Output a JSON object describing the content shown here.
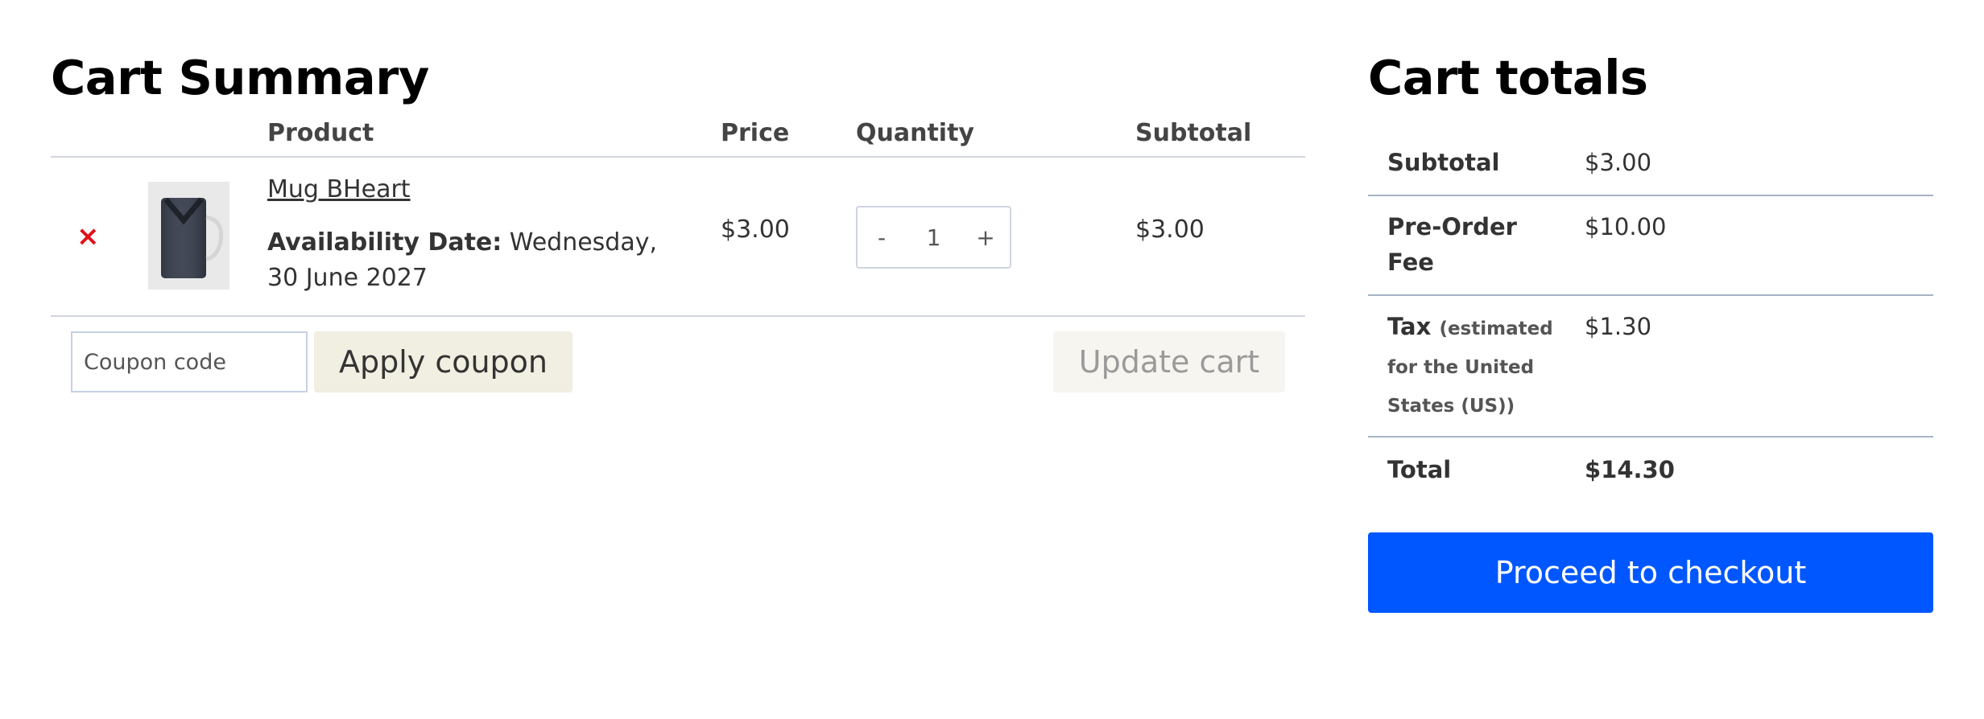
{
  "cart_summary": {
    "title": "Cart Summary",
    "columns": {
      "product": "Product",
      "price": "Price",
      "quantity": "Quantity",
      "subtotal": "Subtotal"
    },
    "items": [
      {
        "remove_symbol": "×",
        "thumbnail_icon": "mug-image",
        "name": "Mug BHeart",
        "availability_label": "Availability Date:",
        "availability_value": " Wednesday, 30 June 2027",
        "price": "$3.00",
        "qty_minus": "-",
        "qty_value": "1",
        "qty_plus": "+",
        "subtotal": "$3.00"
      }
    ],
    "coupon_placeholder": "Coupon code",
    "apply_coupon_label": "Apply coupon",
    "update_cart_label": "Update cart"
  },
  "cart_totals": {
    "title": "Cart totals",
    "rows": [
      {
        "label": "Subtotal",
        "value": "$3.00"
      },
      {
        "label": "Pre-Order Fee",
        "value": "$10.00"
      },
      {
        "label": "Tax",
        "note": "(estimated for the United States (US))",
        "value": "$1.30"
      },
      {
        "label": "Total",
        "value": "$14.30"
      }
    ],
    "checkout_label": "Proceed to checkout"
  },
  "colors": {
    "remove_icon": "#e0101a",
    "checkout_button": "#0057ff",
    "apply_coupon_bg": "#f1eee2",
    "update_cart_bg": "#f6f5f0"
  }
}
